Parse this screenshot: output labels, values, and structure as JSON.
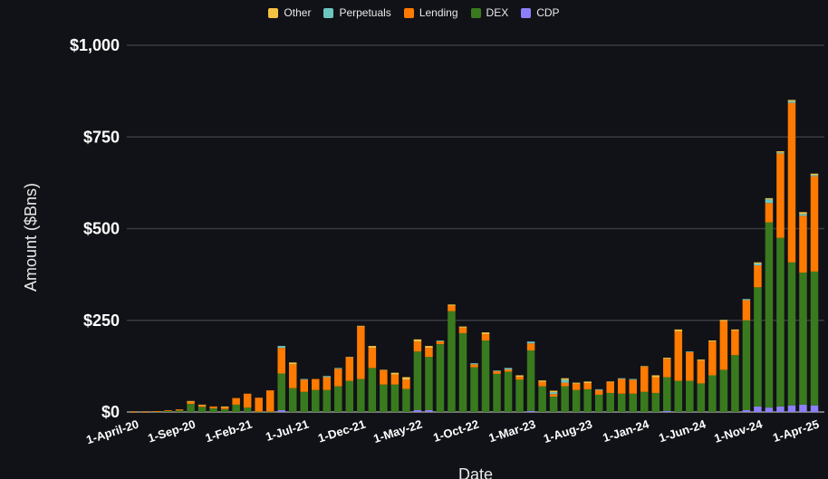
{
  "chart_data": {
    "type": "bar",
    "stacked": true,
    "title": "",
    "xlabel": "Date",
    "ylabel": "Amount ($Bns)",
    "ylim": [
      0,
      1000
    ],
    "yticks": [
      0,
      250,
      500,
      750,
      1000
    ],
    "ytick_labels": [
      "$0",
      "$250",
      "$500",
      "$750",
      "$1,000"
    ],
    "grid": true,
    "legend_position": "top-center",
    "legend_order": [
      "Other",
      "Perpetuals",
      "Lending",
      "DEX",
      "CDP"
    ],
    "categories": [
      "Apr-20",
      "May-20",
      "Jun-20",
      "Jul-20",
      "Aug-20",
      "Sep-20",
      "Oct-20",
      "Nov-20",
      "Dec-20",
      "Jan-21",
      "Feb-21",
      "Mar-21",
      "Apr-21",
      "May-21",
      "Jun-21",
      "Jul-21",
      "Aug-21",
      "Sep-21",
      "Oct-21",
      "Nov-21",
      "Dec-21",
      "Jan-22",
      "Feb-22",
      "Mar-22",
      "Apr-22",
      "May-22",
      "Jun-22",
      "Jul-22",
      "Aug-22",
      "Sep-22",
      "Oct-22",
      "Nov-22",
      "Dec-22",
      "Jan-23",
      "Feb-23",
      "Mar-23",
      "Apr-23",
      "May-23",
      "Jun-23",
      "Jul-23",
      "Aug-23",
      "Sep-23",
      "Oct-23",
      "Nov-23",
      "Dec-23",
      "Jan-24",
      "Feb-24",
      "Mar-24",
      "Apr-24",
      "May-24",
      "Jun-24",
      "Jul-24",
      "Aug-24",
      "Sep-24",
      "Oct-24",
      "Nov-24",
      "Dec-24",
      "Jan-25",
      "Feb-25",
      "Mar-25",
      "Apr-25"
    ],
    "xtick_labels": [
      {
        "index": 0,
        "label": "1-April-20"
      },
      {
        "index": 5,
        "label": "1-Sep-20"
      },
      {
        "index": 10,
        "label": "1-Feb-21"
      },
      {
        "index": 15,
        "label": "1-Jul-21"
      },
      {
        "index": 20,
        "label": "1-Dec-21"
      },
      {
        "index": 25,
        "label": "1-May-22"
      },
      {
        "index": 30,
        "label": "1-Oct-22"
      },
      {
        "index": 35,
        "label": "1-Mar-23"
      },
      {
        "index": 40,
        "label": "1-Aug-23"
      },
      {
        "index": 45,
        "label": "1-Jan-24"
      },
      {
        "index": 50,
        "label": "1-Jun-24"
      },
      {
        "index": 55,
        "label": "1-Nov-24"
      },
      {
        "index": 60,
        "label": "1-Apr-25"
      }
    ],
    "series": [
      {
        "name": "CDP",
        "color": "#8b80f9",
        "values": [
          0,
          0,
          0,
          0,
          0,
          0,
          0,
          0,
          0,
          0,
          0,
          0,
          0,
          5,
          0,
          0,
          0,
          0,
          0,
          0,
          0,
          0,
          0,
          0,
          0,
          5,
          5,
          0,
          0,
          0,
          0,
          0,
          0,
          0,
          0,
          3,
          0,
          0,
          0,
          0,
          0,
          0,
          0,
          0,
          0,
          0,
          0,
          3,
          0,
          0,
          0,
          0,
          0,
          0,
          5,
          15,
          12,
          15,
          18,
          20,
          18
        ]
      },
      {
        "name": "DEX",
        "color": "#3a7a1f",
        "values": [
          0.5,
          0.5,
          1,
          3,
          4,
          22,
          14,
          10,
          8,
          20,
          12,
          1,
          1,
          100,
          65,
          55,
          60,
          60,
          70,
          85,
          90,
          120,
          75,
          75,
          63,
          160,
          145,
          185,
          275,
          215,
          122,
          195,
          104,
          110,
          88,
          165,
          70,
          42,
          70,
          60,
          62,
          47,
          52,
          50,
          50,
          55,
          52,
          92,
          85,
          85,
          78,
          100,
          115,
          155,
          245,
          325,
          505,
          460,
          390,
          360,
          365
        ]
      },
      {
        "name": "Lending",
        "color": "#ff7a00",
        "values": [
          0.3,
          0.5,
          1,
          2,
          3,
          6,
          4,
          5,
          6,
          18,
          38,
          38,
          58,
          70,
          65,
          33,
          30,
          35,
          48,
          63,
          143,
          55,
          38,
          27,
          25,
          27,
          25,
          8,
          15,
          15,
          8,
          17,
          7,
          6,
          8,
          19,
          12,
          7,
          10,
          17,
          17,
          13,
          30,
          40,
          38,
          68,
          43,
          50,
          135,
          78,
          62,
          92,
          133,
          67,
          55,
          60,
          53,
          230,
          435,
          155,
          260
        ]
      },
      {
        "name": "Perpetuals",
        "color": "#6cc5c0",
        "values": [
          0,
          0,
          0,
          0,
          0,
          0,
          0,
          0,
          0,
          0,
          0,
          0,
          0,
          5,
          0,
          2,
          0,
          3,
          2,
          0,
          0,
          0,
          0,
          0,
          0,
          0,
          0,
          2,
          0,
          0,
          3,
          0,
          2,
          4,
          0,
          5,
          0,
          5,
          8,
          0,
          0,
          2,
          0,
          2,
          2,
          0,
          0,
          0,
          0,
          2,
          0,
          0,
          0,
          0,
          3,
          5,
          10,
          3,
          5,
          5,
          3
        ]
      },
      {
        "name": "Other",
        "color": "#f5c242",
        "values": [
          0,
          0,
          0,
          0,
          0,
          2,
          2,
          0,
          1,
          0,
          0,
          0,
          0,
          0,
          5,
          0,
          0,
          0,
          0,
          2,
          2,
          5,
          2,
          5,
          7,
          6,
          5,
          0,
          3,
          3,
          0,
          5,
          0,
          0,
          4,
          0,
          4,
          4,
          4,
          3,
          4,
          0,
          1,
          0,
          0,
          2,
          5,
          3,
          5,
          0,
          3,
          3,
          3,
          3,
          0,
          3,
          3,
          3,
          3,
          5,
          4
        ]
      }
    ]
  }
}
